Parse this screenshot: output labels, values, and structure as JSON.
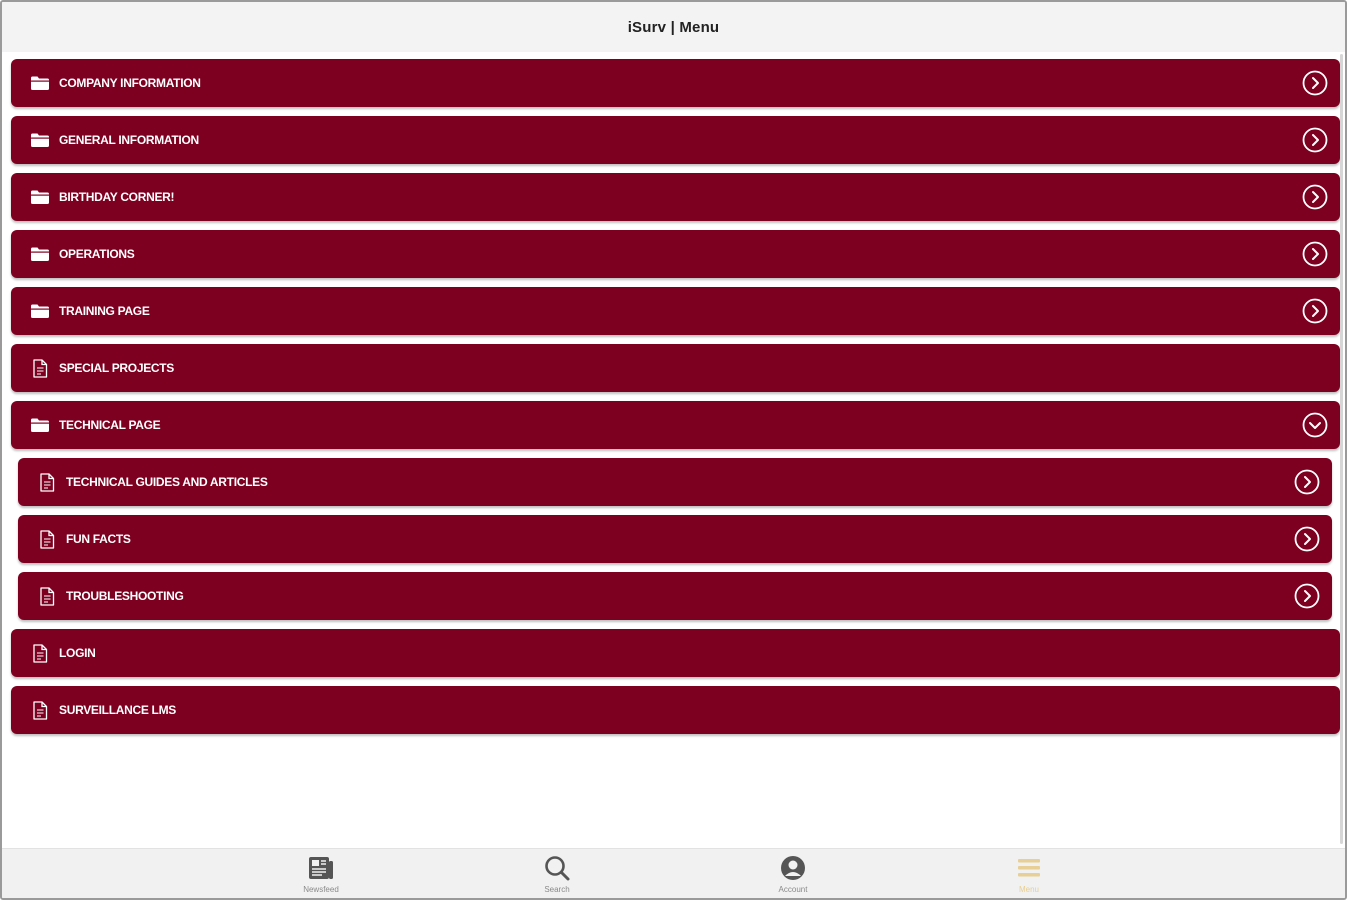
{
  "header": {
    "title": "iSurv | Menu"
  },
  "colors": {
    "row_bg": "#7d0020",
    "row_text": "#ffffff",
    "tab_active": "#e8cf95",
    "tab_inactive": "#555555"
  },
  "menu": {
    "items": [
      {
        "label": "COMPANY INFORMATION",
        "icon": "folder-icon",
        "indicator": "chevron-right-circle-icon"
      },
      {
        "label": "GENERAL INFORMATION",
        "icon": "folder-icon",
        "indicator": "chevron-right-circle-icon"
      },
      {
        "label": "BIRTHDAY CORNER!",
        "icon": "folder-icon",
        "indicator": "chevron-right-circle-icon"
      },
      {
        "label": "OPERATIONS",
        "icon": "folder-icon",
        "indicator": "chevron-right-circle-icon"
      },
      {
        "label": "TRAINING PAGE",
        "icon": "folder-icon",
        "indicator": "chevron-right-circle-icon"
      },
      {
        "label": "SPECIAL PROJECTS",
        "icon": "document-icon",
        "indicator": ""
      },
      {
        "label": "TECHNICAL PAGE",
        "icon": "folder-icon",
        "indicator": "chevron-down-circle-icon",
        "expanded": true,
        "children": [
          {
            "label": "TECHNICAL GUIDES AND ARTICLES",
            "icon": "document-icon",
            "indicator": "chevron-right-circle-icon"
          },
          {
            "label": "FUN FACTS",
            "icon": "document-icon",
            "indicator": "chevron-right-circle-icon"
          },
          {
            "label": "TROUBLESHOOTING",
            "icon": "document-icon",
            "indicator": "chevron-right-circle-icon"
          }
        ]
      },
      {
        "label": "LOGIN",
        "icon": "document-icon",
        "indicator": ""
      },
      {
        "label": "SURVEILLANCE LMS",
        "icon": "document-icon",
        "indicator": ""
      }
    ]
  },
  "tabbar": {
    "tabs": [
      {
        "label": "Newsfeed",
        "icon": "newspaper-icon",
        "active": false
      },
      {
        "label": "Search",
        "icon": "search-icon",
        "active": false
      },
      {
        "label": "Account",
        "icon": "account-icon",
        "active": false
      },
      {
        "label": "Menu",
        "icon": "menu-icon",
        "active": true
      }
    ]
  }
}
